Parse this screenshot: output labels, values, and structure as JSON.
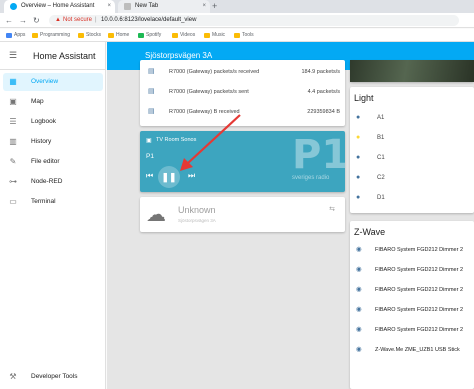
{
  "browser": {
    "tabs": [
      {
        "title": "Overview – Home Assistant",
        "close": "×"
      },
      {
        "title": "New Tab",
        "close": "×"
      }
    ],
    "new_tab": "+",
    "nav": {
      "back": "←",
      "forward": "→",
      "reload": "↻"
    },
    "security_text": "Not secure",
    "url": "10.0.0.6:8123/lovelace/default_view",
    "bookmarks": [
      "Apps",
      "Programming",
      "Stocks",
      "Home",
      "Spotify",
      "Videos",
      "Music",
      "Tools"
    ]
  },
  "sidebar": {
    "title": "Home Assistant",
    "menu_icon": "menu-icon",
    "items": [
      {
        "label": "Overview",
        "icon": "dashboard-icon",
        "active": true
      },
      {
        "label": "Map",
        "icon": "map-icon"
      },
      {
        "label": "Logbook",
        "icon": "logbook-icon"
      },
      {
        "label": "History",
        "icon": "history-icon"
      },
      {
        "label": "File editor",
        "icon": "wrench-icon"
      },
      {
        "label": "Node-RED",
        "icon": "node-red-icon"
      },
      {
        "label": "Terminal",
        "icon": "terminal-icon"
      }
    ],
    "footer": {
      "label": "Developer Tools",
      "icon": "developer-tools-icon"
    }
  },
  "header": {
    "title": "Sjöstorpsvägen 3A"
  },
  "sensors": [
    {
      "name": "R7000 (Gateway) packets/s received",
      "value": "184.9 packets/s"
    },
    {
      "name": "R7000 (Gateway) packets/s sent",
      "value": "4.4 packets/s"
    },
    {
      "name": "R7000 (Gateway) B received",
      "value": "229359834 B"
    }
  ],
  "media": {
    "name": "TV Room Sonos",
    "station": "P1",
    "logo": "P1",
    "logo_sub": "sveriges radio",
    "prev": "⏮",
    "pause": "❚❚",
    "next": "⏭"
  },
  "weather": {
    "state": "Unknown",
    "sub": "Sjöstorpsvägen 3A",
    "attr_icon": "⇆"
  },
  "light": {
    "title": "Light",
    "items": [
      {
        "name": "A1",
        "on": false
      },
      {
        "name": "B1",
        "on": true
      },
      {
        "name": "C1",
        "on": false
      },
      {
        "name": "C2",
        "on": false
      },
      {
        "name": "D1",
        "on": false
      }
    ]
  },
  "zwave": {
    "title": "Z-Wave",
    "items": [
      "FIBARO System FGD212 Dimmer 2",
      "FIBARO System FGD212 Dimmer 2",
      "FIBARO System FGD212 Dimmer 2",
      "FIBARO System FGD212 Dimmer 2",
      "FIBARO System FGD212 Dimmer 2",
      "Z-Wave.Me ZME_UZB1 USB Stick"
    ]
  },
  "colors": {
    "accent": "#03a9f4",
    "media_bg": "#3da5bf",
    "icon": "#44739e",
    "annotation": "#e53935"
  }
}
